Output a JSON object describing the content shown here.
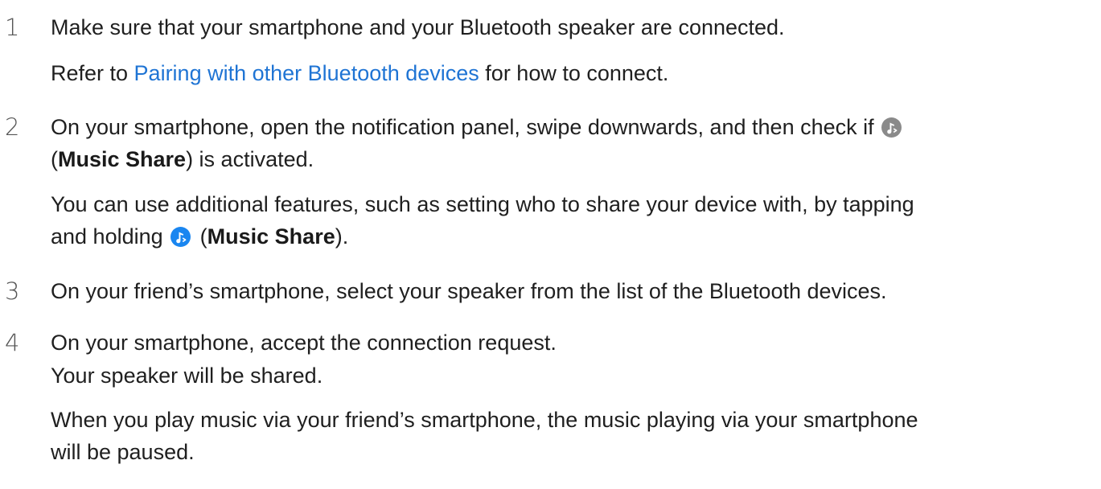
{
  "steps": [
    {
      "number": "1",
      "lines": {
        "l1": "Make sure that your smartphone and your Bluetooth speaker are connected.",
        "l2_pre": "Refer to ",
        "l2_link": "Pairing with other Bluetooth devices",
        "l2_post": " for how to connect."
      }
    },
    {
      "number": "2",
      "lines": {
        "l1": "On your smartphone, open the notification panel, swipe downwards, and then check if",
        "l2_open": "(",
        "l2_bold": "Music Share",
        "l2_post": ") is activated.",
        "l3": "You can use additional features, such as setting who to share your device with, by tapping",
        "l4_pre": "and holding",
        "l4_open": " (",
        "l4_bold": "Music Share",
        "l4_post": ")."
      },
      "icons": {
        "inactive": "music-share-inactive-icon",
        "active": "music-share-active-icon",
        "inactive_color": "#8a8a8a",
        "active_color": "#1a86f0"
      }
    },
    {
      "number": "3",
      "lines": {
        "l1": "On your friend’s smartphone, select your speaker from the list of the Bluetooth devices."
      }
    },
    {
      "number": "4",
      "lines": {
        "l1": "On your smartphone, accept the connection request.",
        "l2": "Your speaker will be shared.",
        "l3": "When you play music via your friend’s smartphone, the music playing via your smartphone",
        "l4": "will be paused."
      }
    }
  ],
  "colors": {
    "link": "#1f74d4",
    "text": "#1f1f1f",
    "step_number": "#555555"
  }
}
